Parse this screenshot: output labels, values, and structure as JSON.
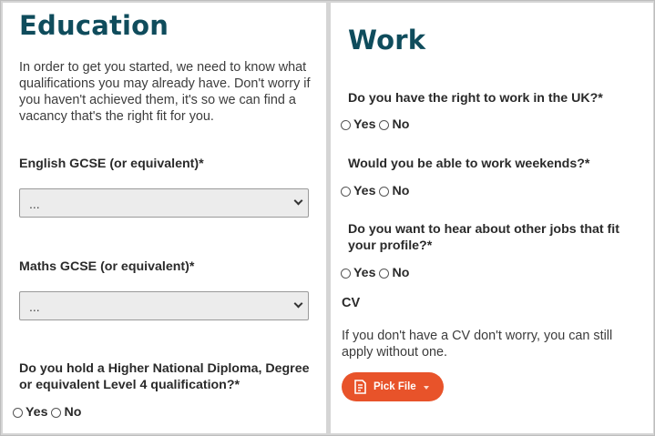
{
  "education": {
    "title": "Education",
    "intro": "In order to get you started, we need to know what qualifications you may already have. Don't worry if you haven't achieved them, it's so we can find a vacancy that's the right fit for you.",
    "english_label": "English GCSE (or equivalent)*",
    "english_value": "...",
    "maths_label": "Maths GCSE (or equivalent)*",
    "maths_value": "...",
    "hnd_label_line1": "Do you hold a Higher National Diploma, Degree",
    "hnd_label_line2": "or equivalent Level 4 qualification?*",
    "yes": "Yes",
    "no": "No"
  },
  "work": {
    "title": "Work",
    "q_right_to_work": "Do you have the right to work in the UK?*",
    "q_weekends": "Would you be able to work weekends?*",
    "q_other_jobs_line1": "Do you want to hear about other jobs that fit",
    "q_other_jobs_line2": "your profile?*",
    "yes": "Yes",
    "no": "No"
  },
  "cv": {
    "title": "CV",
    "text": "If you don't have a CV don't worry, you can still apply without one.",
    "pick_file": "Pick File"
  },
  "colors": {
    "heading": "#0f4c5c",
    "button": "#e8532a"
  }
}
